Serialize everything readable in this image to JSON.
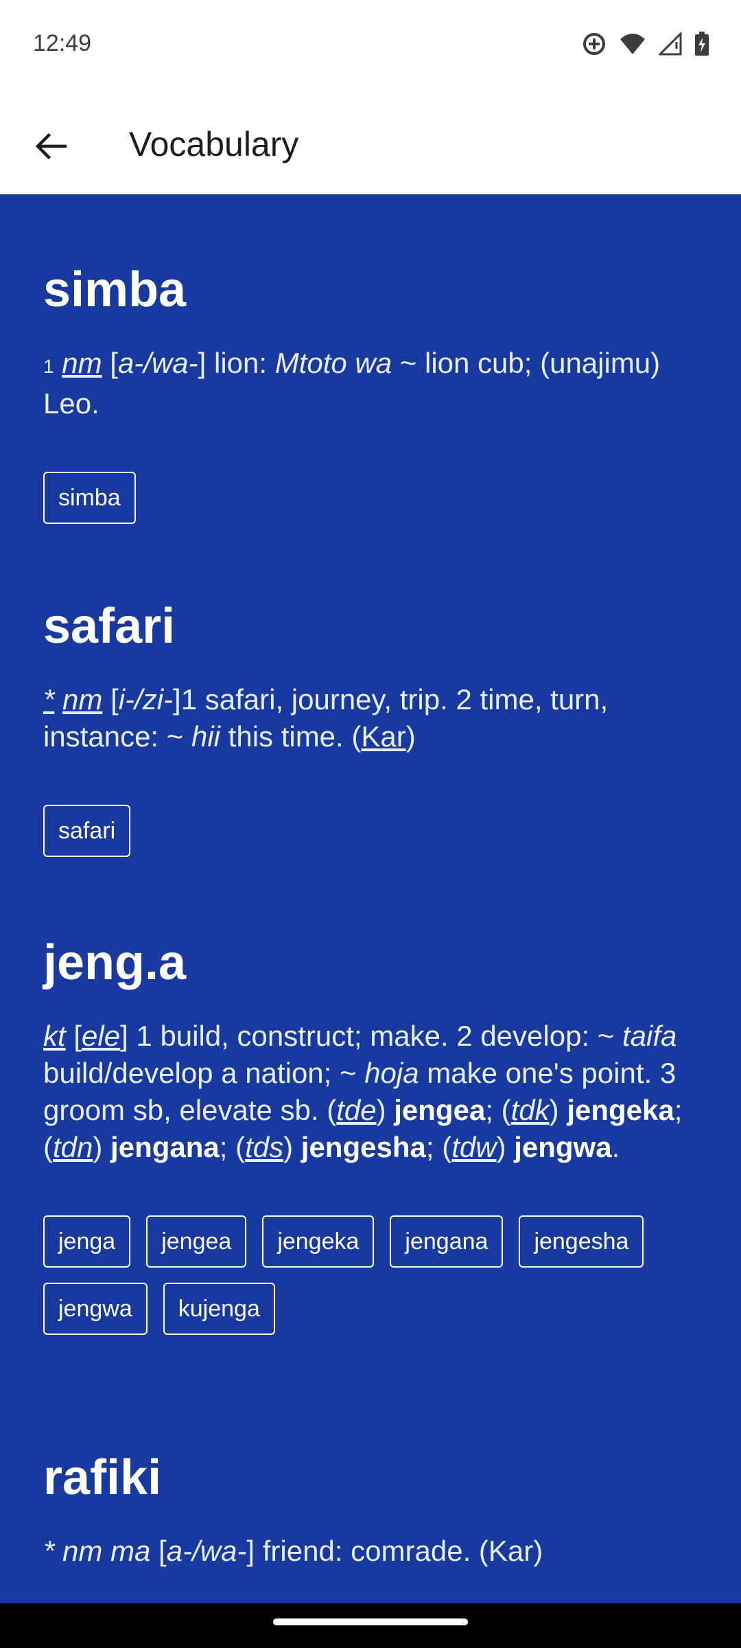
{
  "status": {
    "time": "12:49",
    "icons": [
      "sync-icon",
      "wifi-icon",
      "signal-icon",
      "battery-icon"
    ]
  },
  "app_bar": {
    "title": "Vocabulary",
    "back_icon": "arrow-left-icon"
  },
  "colors": {
    "background": "#1739a0",
    "text": "#ffffff",
    "app_bar": "#ffffff"
  },
  "entries": [
    {
      "word": "simba",
      "definition": {
        "sense_num": "1",
        "pos": "nm",
        "class_open": "[",
        "class": "a-/wa-",
        "class_close": "]",
        "text1": " lion: ",
        "example": "Mtoto wa",
        "text2": " ~ lion cub; (unajimu) Leo."
      },
      "chips": [
        "simba"
      ]
    },
    {
      "word": "safari",
      "definition": {
        "star": "*",
        "pos": "nm",
        "class_open": "[",
        "class": "i-/zi-",
        "class_close": "]",
        "text1": "1 safari, journey, trip. 2 time, turn, instance: ~ ",
        "example": "hii",
        "text2": " this time. (",
        "origin": "Kar",
        "text3": ")"
      },
      "chips": [
        "safari"
      ]
    },
    {
      "word": "jeng.a",
      "definition": {
        "pos": "kt",
        "class_open": "[",
        "class": "ele",
        "class_close": "]",
        "text1": " 1 build, construct; make. 2 develop: ~ ",
        "ex1": "taifa",
        "text2": " build/develop a nation; ~ ",
        "ex2": "hoja",
        "text3": " make one's point. 3 groom sb, elevate sb. (",
        "d1": "tde",
        "t4": ") ",
        "w1": "jengea",
        "t5": "; (",
        "d2": "tdk",
        "t6": ") ",
        "w2": "jengeka",
        "t7": "; (",
        "d3": "tdn",
        "t8": ") ",
        "w3": "jengana",
        "t9": "; (",
        "d4": "tds",
        "t10": ") ",
        "w4": "jengesha",
        "t11": "; (",
        "d5": "tdw",
        "t12": ") ",
        "w5": "jengwa",
        "t13": "."
      },
      "chips": [
        "jenga",
        "jengea",
        "jengeka",
        "jengana",
        "jengesha",
        "jengwa",
        "kujenga"
      ]
    },
    {
      "word": "rafiki",
      "definition": {
        "star": "* nm ma",
        "class_open": " [",
        "class": "a-/wa-",
        "class_close": "]",
        "text1": " friend: comrade. (Kar)"
      }
    }
  ]
}
